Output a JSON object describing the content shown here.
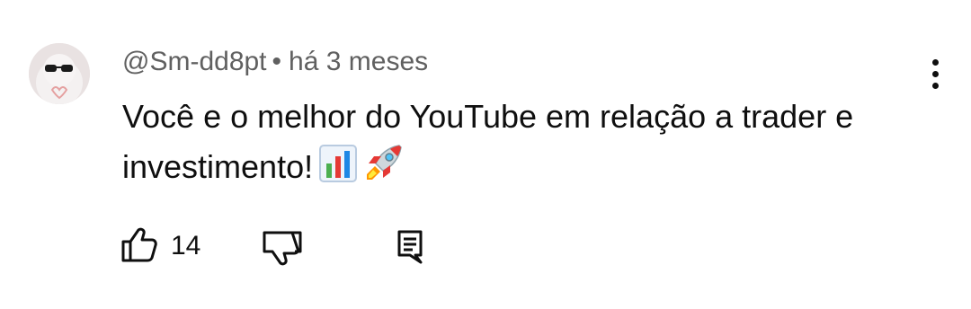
{
  "comment": {
    "author": "@Sm-dd8pt",
    "separator": "•",
    "time": "há 3 meses",
    "text": "Você e o melhor do YouTube em relação a trader e investimento!",
    "emojis": [
      "bar-chart-emoji",
      "rocket-emoji"
    ],
    "like_count": "14"
  },
  "icons": {
    "avatar": "avatar",
    "more": "more-vert-icon",
    "like": "thumb-up-icon",
    "dislike": "thumb-down-icon",
    "reply": "comment-reply-icon"
  }
}
